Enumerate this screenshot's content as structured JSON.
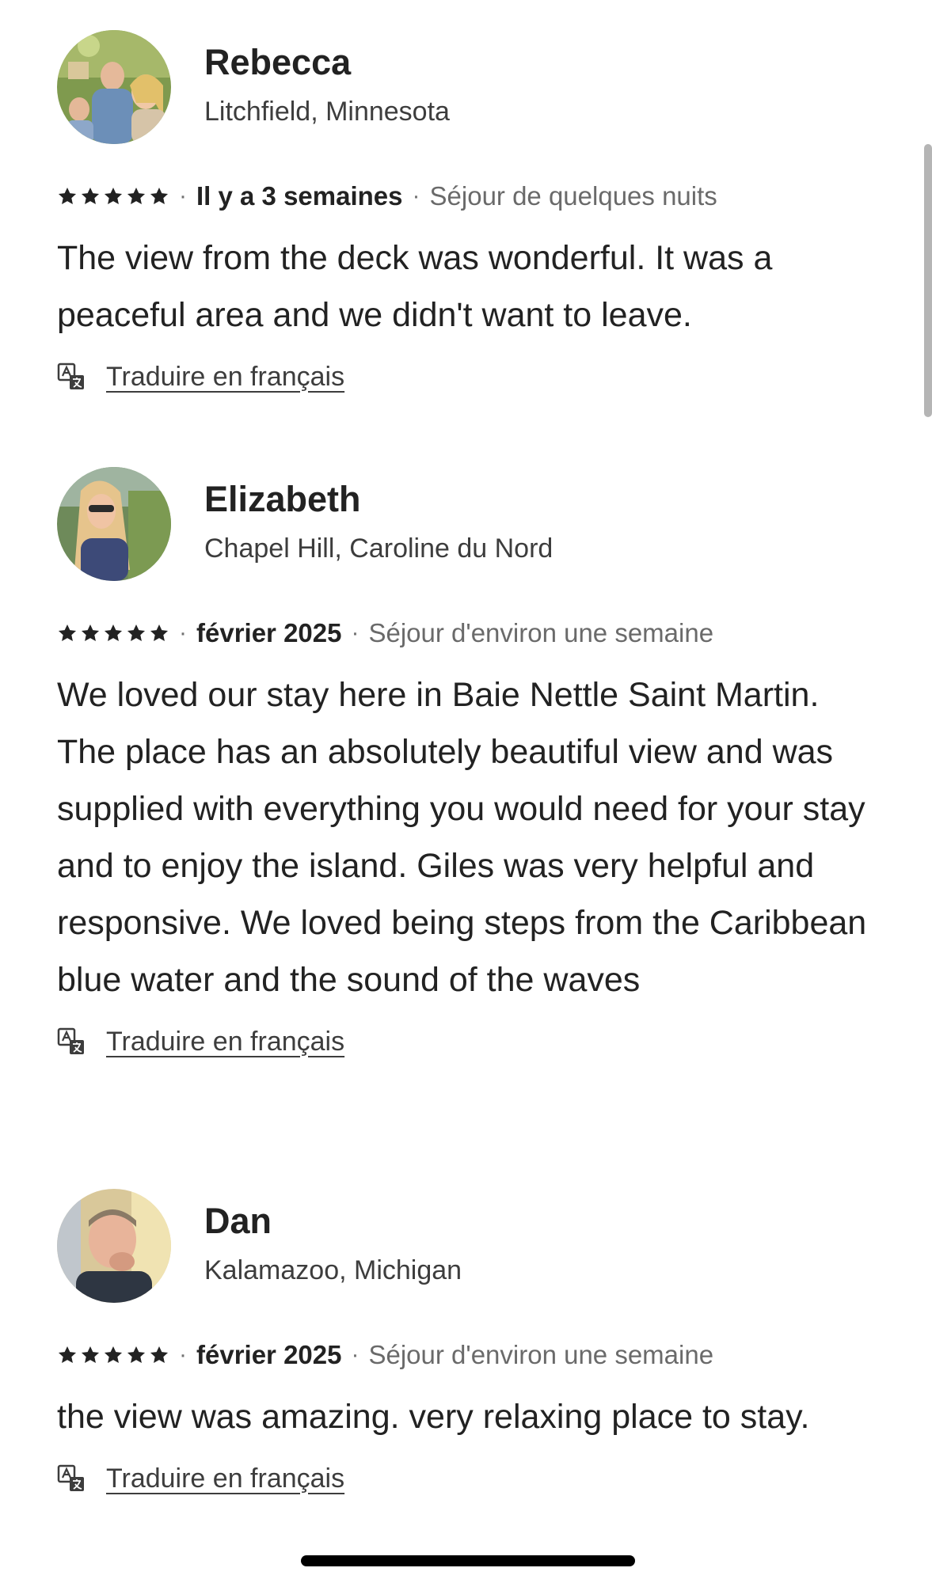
{
  "reviews": [
    {
      "name": "Rebecca",
      "location": "Litchfield, Minnesota",
      "rating": 5,
      "date": "Il y a 3 semaines",
      "stay": "Séjour de quelques nuits",
      "text": "The view from the deck was wonderful.  It was a peaceful area and we didn't want to leave.",
      "translate_label": "Traduire en français"
    },
    {
      "name": "Elizabeth",
      "location": "Chapel Hill, Caroline du Nord",
      "rating": 5,
      "date": "février 2025",
      "stay": "Séjour d'environ une semaine",
      "text": "We loved our stay here in Baie Nettle Saint Martin. The place has an absolutely beautiful view and was supplied with everything you would need for your stay and to enjoy the island. Giles was very helpful and responsive. We loved being steps from the Caribbean blue water and the sound of the waves",
      "translate_label": "Traduire en français"
    },
    {
      "name": "Dan",
      "location": "Kalamazoo, Michigan",
      "rating": 5,
      "date": "février 2025",
      "stay": "Séjour d'environ une semaine",
      "text": "the view was amazing. very relaxing place to stay.",
      "translate_label": "Traduire en français"
    }
  ],
  "separator": "·",
  "icons": {
    "star": "star-icon",
    "translate": "translate-icon"
  },
  "colors": {
    "text_primary": "#222222",
    "text_secondary": "#6a6a6a",
    "scrollbar": "#b5b5b5"
  }
}
